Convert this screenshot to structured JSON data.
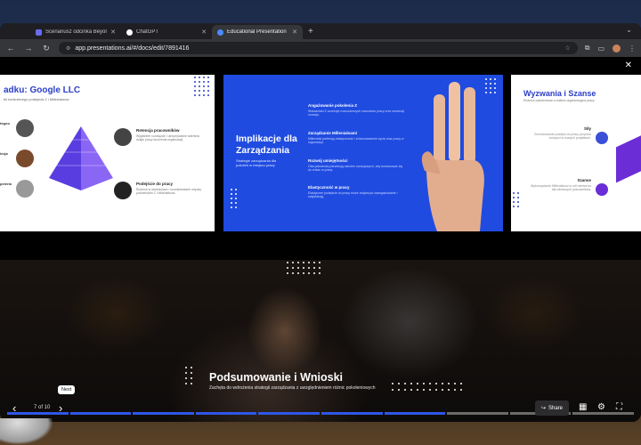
{
  "browser": {
    "tabs": [
      {
        "title": "Scenariusz odcinka Beyond",
        "favicon_color": "#6a6cf0",
        "active": false
      },
      {
        "title": "ChatGPT",
        "favicon_color": "#ffffff",
        "active": false
      },
      {
        "title": "Educational Presentation",
        "favicon_color": "#4a8cff",
        "active": true
      }
    ],
    "new_tab": "+",
    "url": "app.presentations.ai/#/docs/edit/7891416"
  },
  "slides": {
    "slide1": {
      "title": "adku: Google LLC",
      "subtitle": "tki konkretnego podejścia Z i Millenialsów",
      "side_labels": [
        "tegoo",
        "iezja",
        "peleria"
      ],
      "items": [
        {
          "heading": "Retencja pracowników",
          "text": "Wyjaśnień rozwiązań i utrzymywanie talentów dzięki pracy tworzenia organizacji."
        },
        {
          "heading": "Podejście do pracy",
          "text": "Różnice w wartościach i oczekiwaniach między pokoleniami Z i Millenialsów."
        }
      ]
    },
    "slide2": {
      "title": "Implikacje dla Zarządzania",
      "subtitle": "Strategie zarządzania dla pokoleń w miejscu pracy",
      "items": [
        {
          "heading": "Angażowanie pokolenia Z",
          "text": "Wskazówki Z oczekuje nowoczesnych warunków pracy oraz swobody rozwoju."
        },
        {
          "heading": "Zarządzanie Millenialsami",
          "text": "Millenialsi preferują elastyczność i zrównoważenie życia oraz pracy w organizacji."
        },
        {
          "heading": "Rozwój umiejętności",
          "text": "Oba pokolenia potrzebują szkoleń rozwojowych, aby dostosować się do zmian w pracy."
        },
        {
          "heading": "Elastyczność w pracy",
          "text": "Elastyczne podejście do pracy może zwiększyć zaangażowanie i satysfakcję."
        }
      ]
    },
    "slide3": {
      "title": "Wyzwania i Szanse",
      "subtitle": "Różnice pokoleniowe a kultura organizacyjna pracy",
      "items": [
        {
          "heading": "Siły",
          "text": "Zróżnicowanie podejść do pracy przynosi korzyści w nowych projektach."
        },
        {
          "heading": "Szanse",
          "text": "Wykorzystanie Millenialsów w roli mentorów dla młodszych pracowników."
        }
      ]
    },
    "main": {
      "title": "Podsumowanie i Wnioski",
      "subtitle": "Zachęta do wdrożenia strategii zarządzania z uwzględnieniem różnic pokoleniowych"
    }
  },
  "progress": {
    "total": 10,
    "current": 7
  },
  "controls": {
    "counter": "7 of 10",
    "tooltip": "Next",
    "share": "Share",
    "accent": "#2f56e8"
  }
}
